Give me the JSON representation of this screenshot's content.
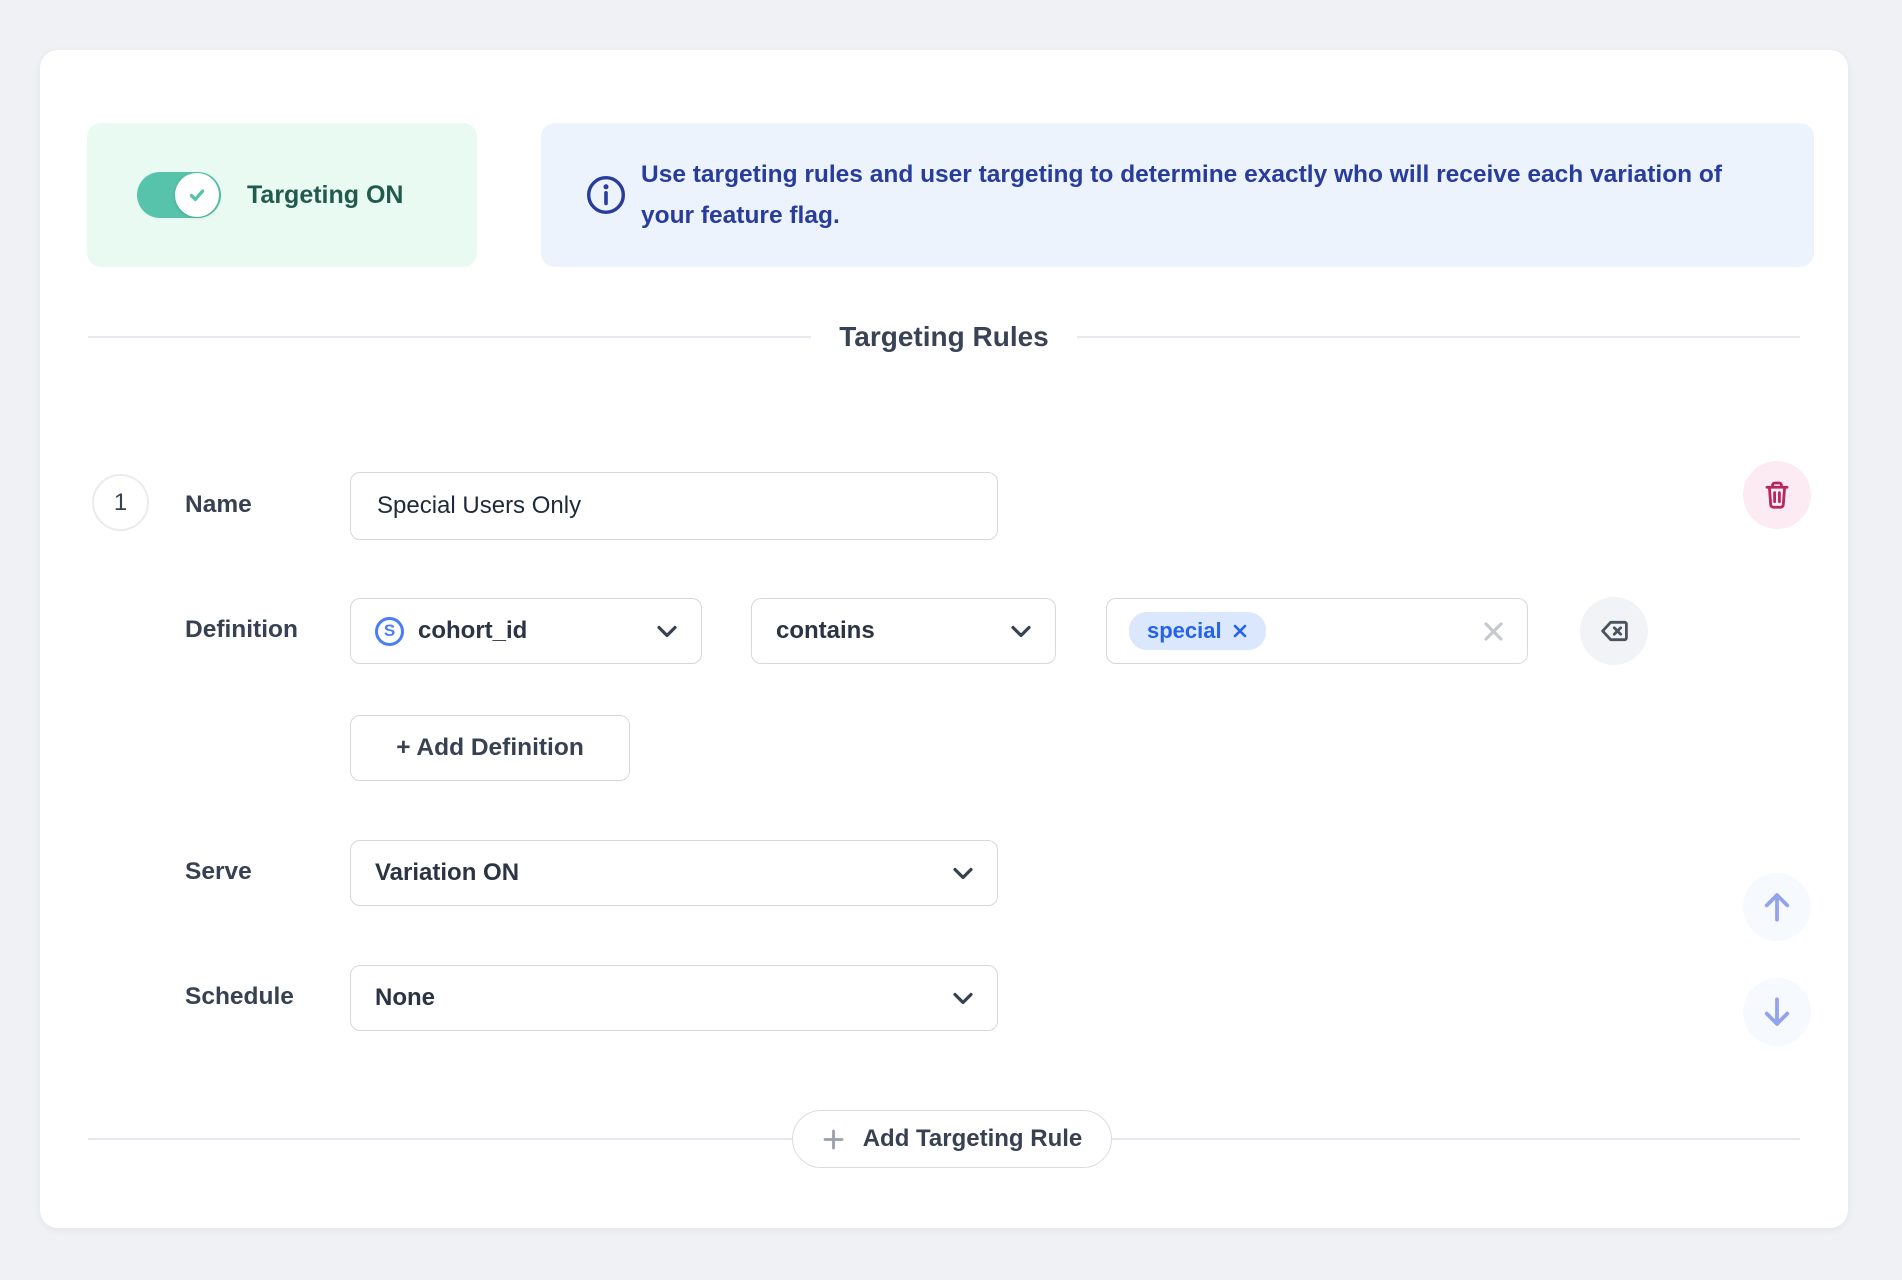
{
  "targeting_toggle": {
    "label": "Targeting ON",
    "state": "on"
  },
  "info_banner": {
    "text": "Use targeting rules and user targeting to determine exactly who will receive each variation of your feature flag."
  },
  "section": {
    "title": "Targeting Rules"
  },
  "rule": {
    "number": "1",
    "name_label": "Name",
    "name_value": "Special Users Only",
    "definition_label": "Definition",
    "definition": {
      "field_badge": "S",
      "field": "cohort_id",
      "operator": "contains",
      "values": [
        "special"
      ]
    },
    "add_definition_label": "+ Add Definition",
    "serve_label": "Serve",
    "serve_value": "Variation ON",
    "schedule_label": "Schedule",
    "schedule_value": "None"
  },
  "footer": {
    "add_rule_label": "Add Targeting Rule"
  },
  "colors": {
    "toggle_on": "#57c3aa",
    "banner_text_blue": "#283c9c",
    "tag_blue": "#2563eb",
    "danger_pink": "#b5295c",
    "arrow_blue": "#93a3ec",
    "page_bg": "#eff1f4"
  }
}
